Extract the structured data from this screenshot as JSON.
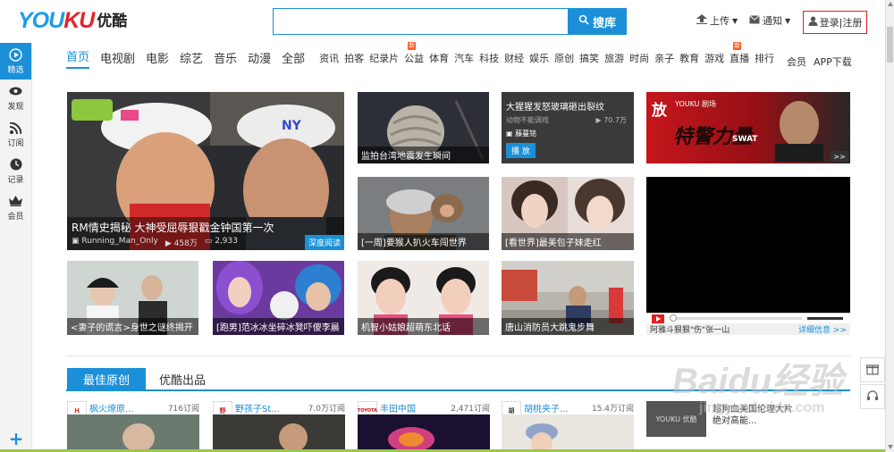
{
  "header": {
    "logo_en_a": "YOU",
    "logo_en_b": "KU",
    "logo_cn": "优酷",
    "search_placeholder": "",
    "search_button": "搜库",
    "upload": "上传",
    "notify": "通知",
    "login": "登录|注册"
  },
  "rail": [
    {
      "label": "精选",
      "icon": "play-icon",
      "active": true
    },
    {
      "label": "发现",
      "icon": "eye-icon"
    },
    {
      "label": "订阅",
      "icon": "rss-icon"
    },
    {
      "label": "记录",
      "icon": "clock-icon"
    },
    {
      "label": "会员",
      "icon": "crown-icon"
    }
  ],
  "rail_plus": "+",
  "nav": {
    "main": [
      "首页",
      "电视剧",
      "电影",
      "综艺",
      "音乐",
      "动漫",
      "全部"
    ],
    "sub": [
      "资讯",
      "拍客",
      "纪录片",
      "公益",
      "体育",
      "汽车",
      "科技",
      "财经",
      "娱乐",
      "原创",
      "搞笑",
      "旅游",
      "时尚",
      "亲子",
      "教育",
      "游戏",
      "直播",
      "排行"
    ],
    "new_badge": "新",
    "vip": "会员",
    "app": "APP下载"
  },
  "feature": {
    "title": "RM情史揭秘 大神受屈辱狠戳金钟国第一次",
    "channel": "Running_Man_Only",
    "plays": "458万",
    "comments": "2,933",
    "tag": "深度阅读"
  },
  "tiles": [
    {
      "caption": "监拍台湾地震发生瞬间"
    },
    {
      "caption": "[一周]要猴人扒火车闯世界"
    },
    {
      "caption": "[看世界]最美包子妹走红"
    },
    {
      "caption": "<妻子的谎言>身世之谜终揭开"
    },
    {
      "caption": "[跑男]范冰冰坐碎冰凳吓傻李晨"
    },
    {
      "caption": "机智小姑娘超萌东北话"
    },
    {
      "caption": "唐山消防员大跳鬼步舞"
    }
  ],
  "promo": {
    "title": "大猩猩发怒玻璃砸出裂纹",
    "sub": "动物不能调戏",
    "views": "70.7万",
    "author": "藤蔓铭",
    "button": "播 放"
  },
  "ad": {
    "brand": "放",
    "sub": "YOUKU 剧场",
    "title": "特警力量",
    "swat": "SWAT",
    "arrow": ">>"
  },
  "player": {
    "caption": "阿雅斗狠狠\"伤\"张一山",
    "more": "详细信息 >>",
    "progress": 0.0
  },
  "section": {
    "tab_active": "最佳原创",
    "tab": "优酷出品"
  },
  "channels": [
    {
      "avatar": "H",
      "name": "枫火燎原...",
      "subs": "716订阅"
    },
    {
      "avatar": "野",
      "name": "野孩子St...",
      "subs": "7.0万订阅"
    },
    {
      "avatar": "TOYOTA",
      "name": "丰田中国",
      "subs": "2,471订阅"
    },
    {
      "avatar": "胡",
      "name": "胡桃夹子...",
      "subs": "15.4万订阅"
    }
  ],
  "side_ad": {
    "img": "YOUKU 优酷",
    "line1": "超狗血美国伦理大片",
    "line2": "绝对高能..."
  },
  "watermark": {
    "text": "Baidu经验",
    "sub": "jingyan.baidu.com"
  },
  "colors": {
    "accent": "#1b8fd8",
    "brand_red": "#e6212b",
    "login_border": "#e02020",
    "new_badge": "#ff5a1e"
  }
}
